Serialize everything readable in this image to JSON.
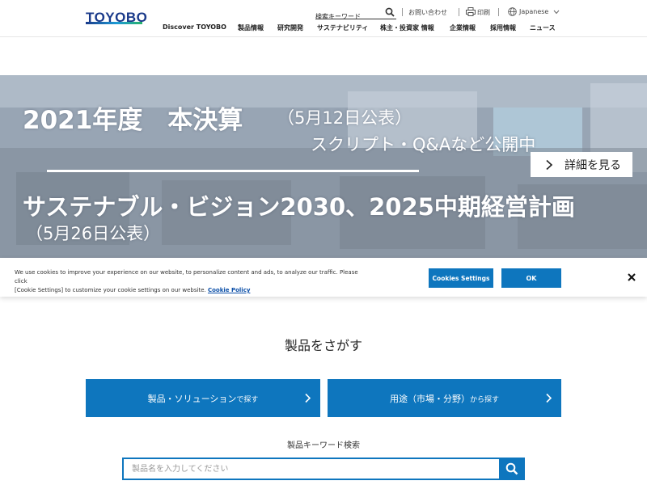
{
  "header": {
    "logo": "TOYOBO",
    "search_placeholder": "検索キーワード",
    "contact": "お問い合わせ",
    "print": "印刷",
    "language": "Japanese",
    "nav": [
      "Discover TOYOBO",
      "製品情報",
      "研究開発",
      "サステナビリティ",
      "株主・投資家 情報",
      "企業情報",
      "採用情報",
      "ニュース"
    ]
  },
  "hero": {
    "line1": "2021年度　本決算",
    "line1_sub": "（5月12日公表）",
    "line2": "スクリプト・Q&Aなど公開中",
    "line3": "サステナブル・ビジョン2030、2025中期経営計画",
    "line4": "（5月26日公表）",
    "detail_button": "詳細を見る"
  },
  "cookie": {
    "text_line1": "We use cookies to improve your experience on our website, to personalize content and ads, to analyze our traffic. Please click",
    "text_line2": "[Cookie Settings] to customize your cookie settings on our website.",
    "policy_link": "Cookie Policy",
    "settings_button": "Cookies Settings",
    "ok_button": "OK"
  },
  "product_search": {
    "title": "製品をさがす",
    "button_solution_main": "製品・ソリューション",
    "button_solution_suffix": "で探す",
    "button_usage_main": "用途（市場・分野）",
    "button_usage_suffix": "から探す",
    "keyword_label": "製品キーワード検索",
    "keyword_placeholder": "製品名を入力してください"
  },
  "colors": {
    "brand_blue": "#0e76be",
    "logo_navy": "#1a3a8a"
  }
}
